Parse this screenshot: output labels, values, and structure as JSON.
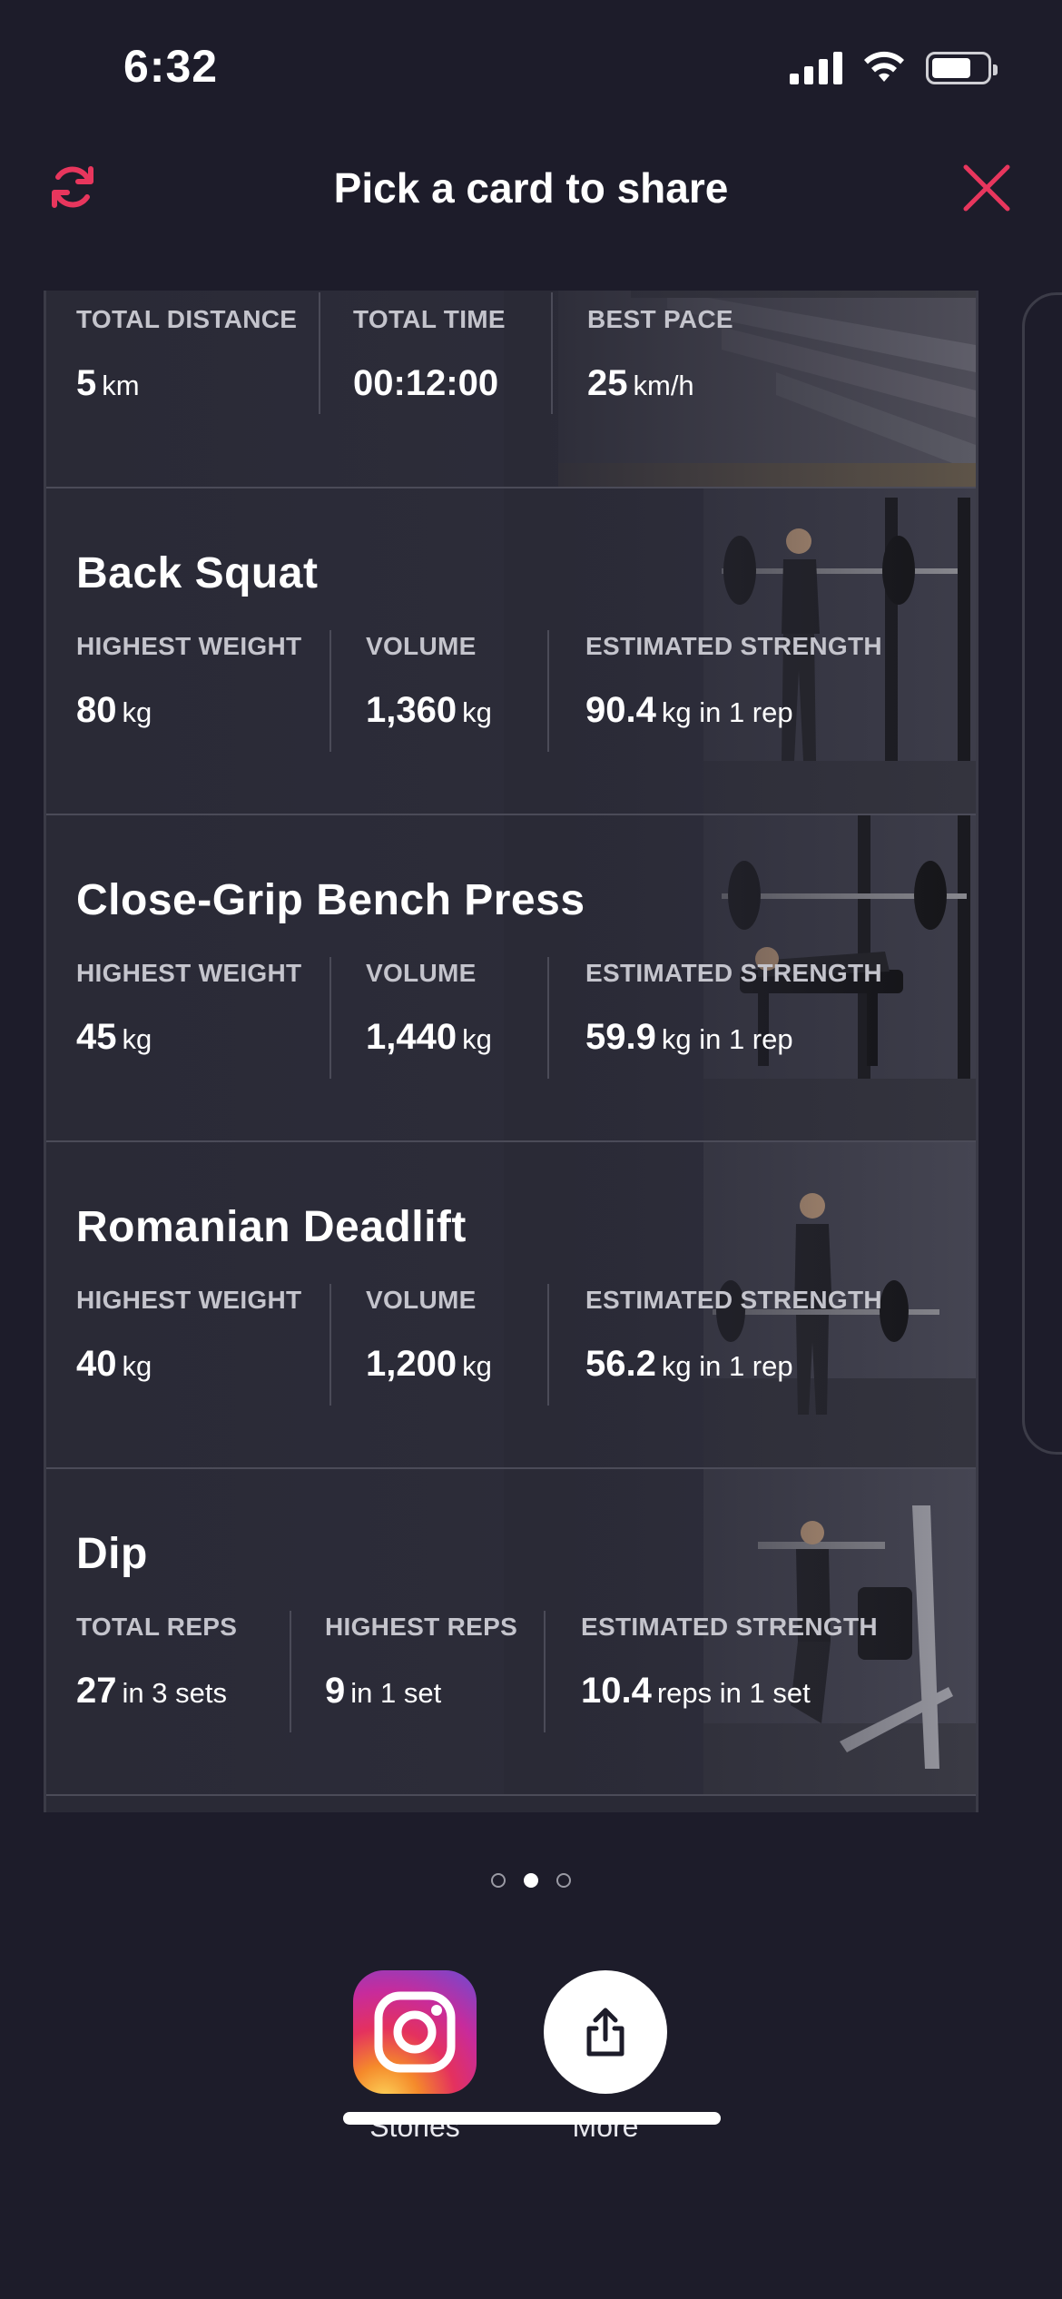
{
  "status_bar": {
    "time": "6:32"
  },
  "header": {
    "title": "Pick a card to share"
  },
  "sections": [
    {
      "title": "",
      "stats": [
        {
          "label": "TOTAL DISTANCE",
          "value": "5",
          "unit": "km"
        },
        {
          "label": "TOTAL TIME",
          "value": "00:12:00",
          "unit": ""
        },
        {
          "label": "BEST PACE",
          "value": "25",
          "unit": "km/h"
        }
      ]
    },
    {
      "title": "Back Squat",
      "stats": [
        {
          "label": "HIGHEST WEIGHT",
          "value": "80",
          "unit": "kg"
        },
        {
          "label": "VOLUME",
          "value": "1,360",
          "unit": "kg"
        },
        {
          "label": "ESTIMATED STRENGTH",
          "value": "90.4",
          "unit": "kg in 1 rep"
        }
      ]
    },
    {
      "title": "Close-Grip Bench Press",
      "stats": [
        {
          "label": "HIGHEST WEIGHT",
          "value": "45",
          "unit": "kg"
        },
        {
          "label": "VOLUME",
          "value": "1,440",
          "unit": "kg"
        },
        {
          "label": "ESTIMATED STRENGTH",
          "value": "59.9",
          "unit": "kg in 1 rep"
        }
      ]
    },
    {
      "title": "Romanian Deadlift",
      "stats": [
        {
          "label": "HIGHEST WEIGHT",
          "value": "40",
          "unit": "kg"
        },
        {
          "label": "VOLUME",
          "value": "1,200",
          "unit": "kg"
        },
        {
          "label": "ESTIMATED STRENGTH",
          "value": "56.2",
          "unit": "kg in 1 rep"
        }
      ]
    },
    {
      "title": "Dip",
      "stats": [
        {
          "label": "TOTAL REPS",
          "value": "27",
          "unit": "in 3 sets"
        },
        {
          "label": "HIGHEST REPS",
          "value": "9",
          "unit": "in 1 set"
        },
        {
          "label": "ESTIMATED STRENGTH",
          "value": "10.4",
          "unit": "reps in 1 set"
        }
      ]
    }
  ],
  "pagination": {
    "count": 3,
    "active_index": 1
  },
  "share": {
    "stories_label": "Stories",
    "more_label": "More",
    "stories_icon": "instagram-icon",
    "more_icon": "share-icon"
  },
  "colors": {
    "accent": "#e8365d",
    "background": "#1d1c2a",
    "card": "#2a2a36"
  }
}
